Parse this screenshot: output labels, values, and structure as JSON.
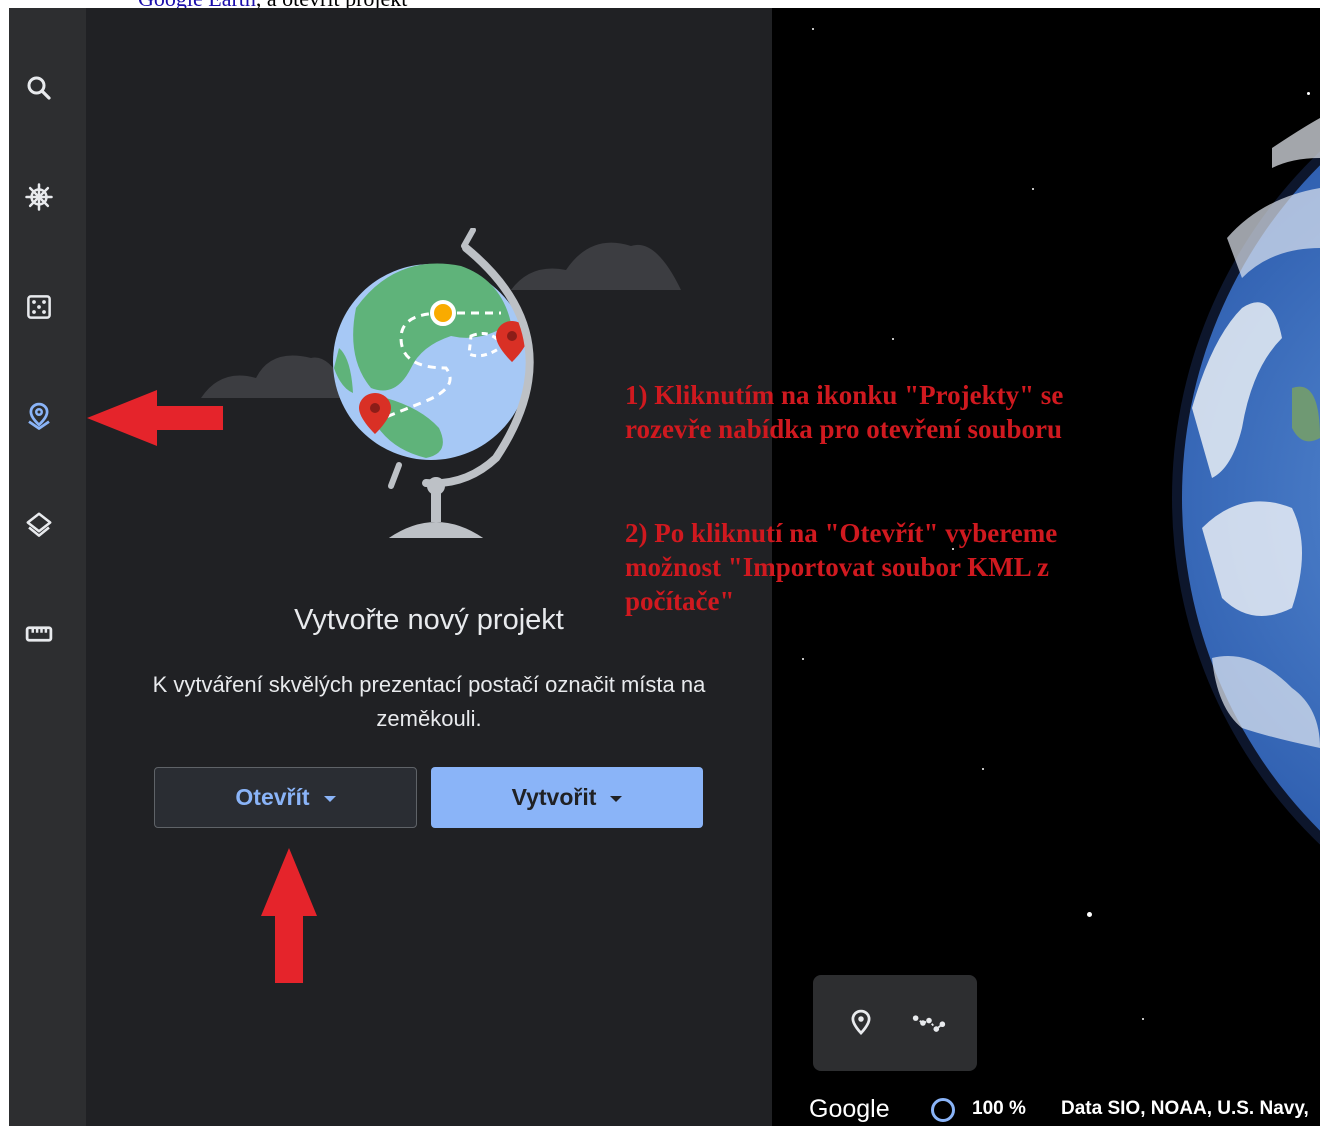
{
  "document": {
    "cut_link_text": "Google Earth",
    "cut_text": "a otevřít projekt"
  },
  "rail": {
    "items": [
      {
        "name": "search",
        "icon": "search-icon"
      },
      {
        "name": "voyager",
        "icon": "ship-wheel-icon"
      },
      {
        "name": "feeling-lucky",
        "icon": "dice-icon"
      },
      {
        "name": "projects",
        "icon": "map-pin-icon",
        "active": true
      },
      {
        "name": "map-style",
        "icon": "layers-icon"
      },
      {
        "name": "measure",
        "icon": "ruler-icon"
      }
    ],
    "active_color": "#8ab4f8"
  },
  "panel": {
    "title": "Vytvořte nový projekt",
    "description": "K vytváření skvělých prezentací postačí označit místa na zeměkouli.",
    "open_button": "Otevřít",
    "create_button": "Vytvořit"
  },
  "annotations": {
    "step1": "1) Kliknutím na ikonku \"Projekty\" se rozevře nabídka pro otevření souboru",
    "step2": "2) Po kliknutí na \"Otevřít\" vybereme možnost \"Importovat soubor KML z počítače\"",
    "color": "#d0191f"
  },
  "map_tools": {
    "items": [
      {
        "name": "add-placemark",
        "icon": "map-pin-icon"
      },
      {
        "name": "draw-path",
        "icon": "path-icon"
      }
    ]
  },
  "status": {
    "logo": "Google",
    "zoom": "100 %",
    "attribution": "Data SIO, NOAA, U.S. Navy,"
  }
}
